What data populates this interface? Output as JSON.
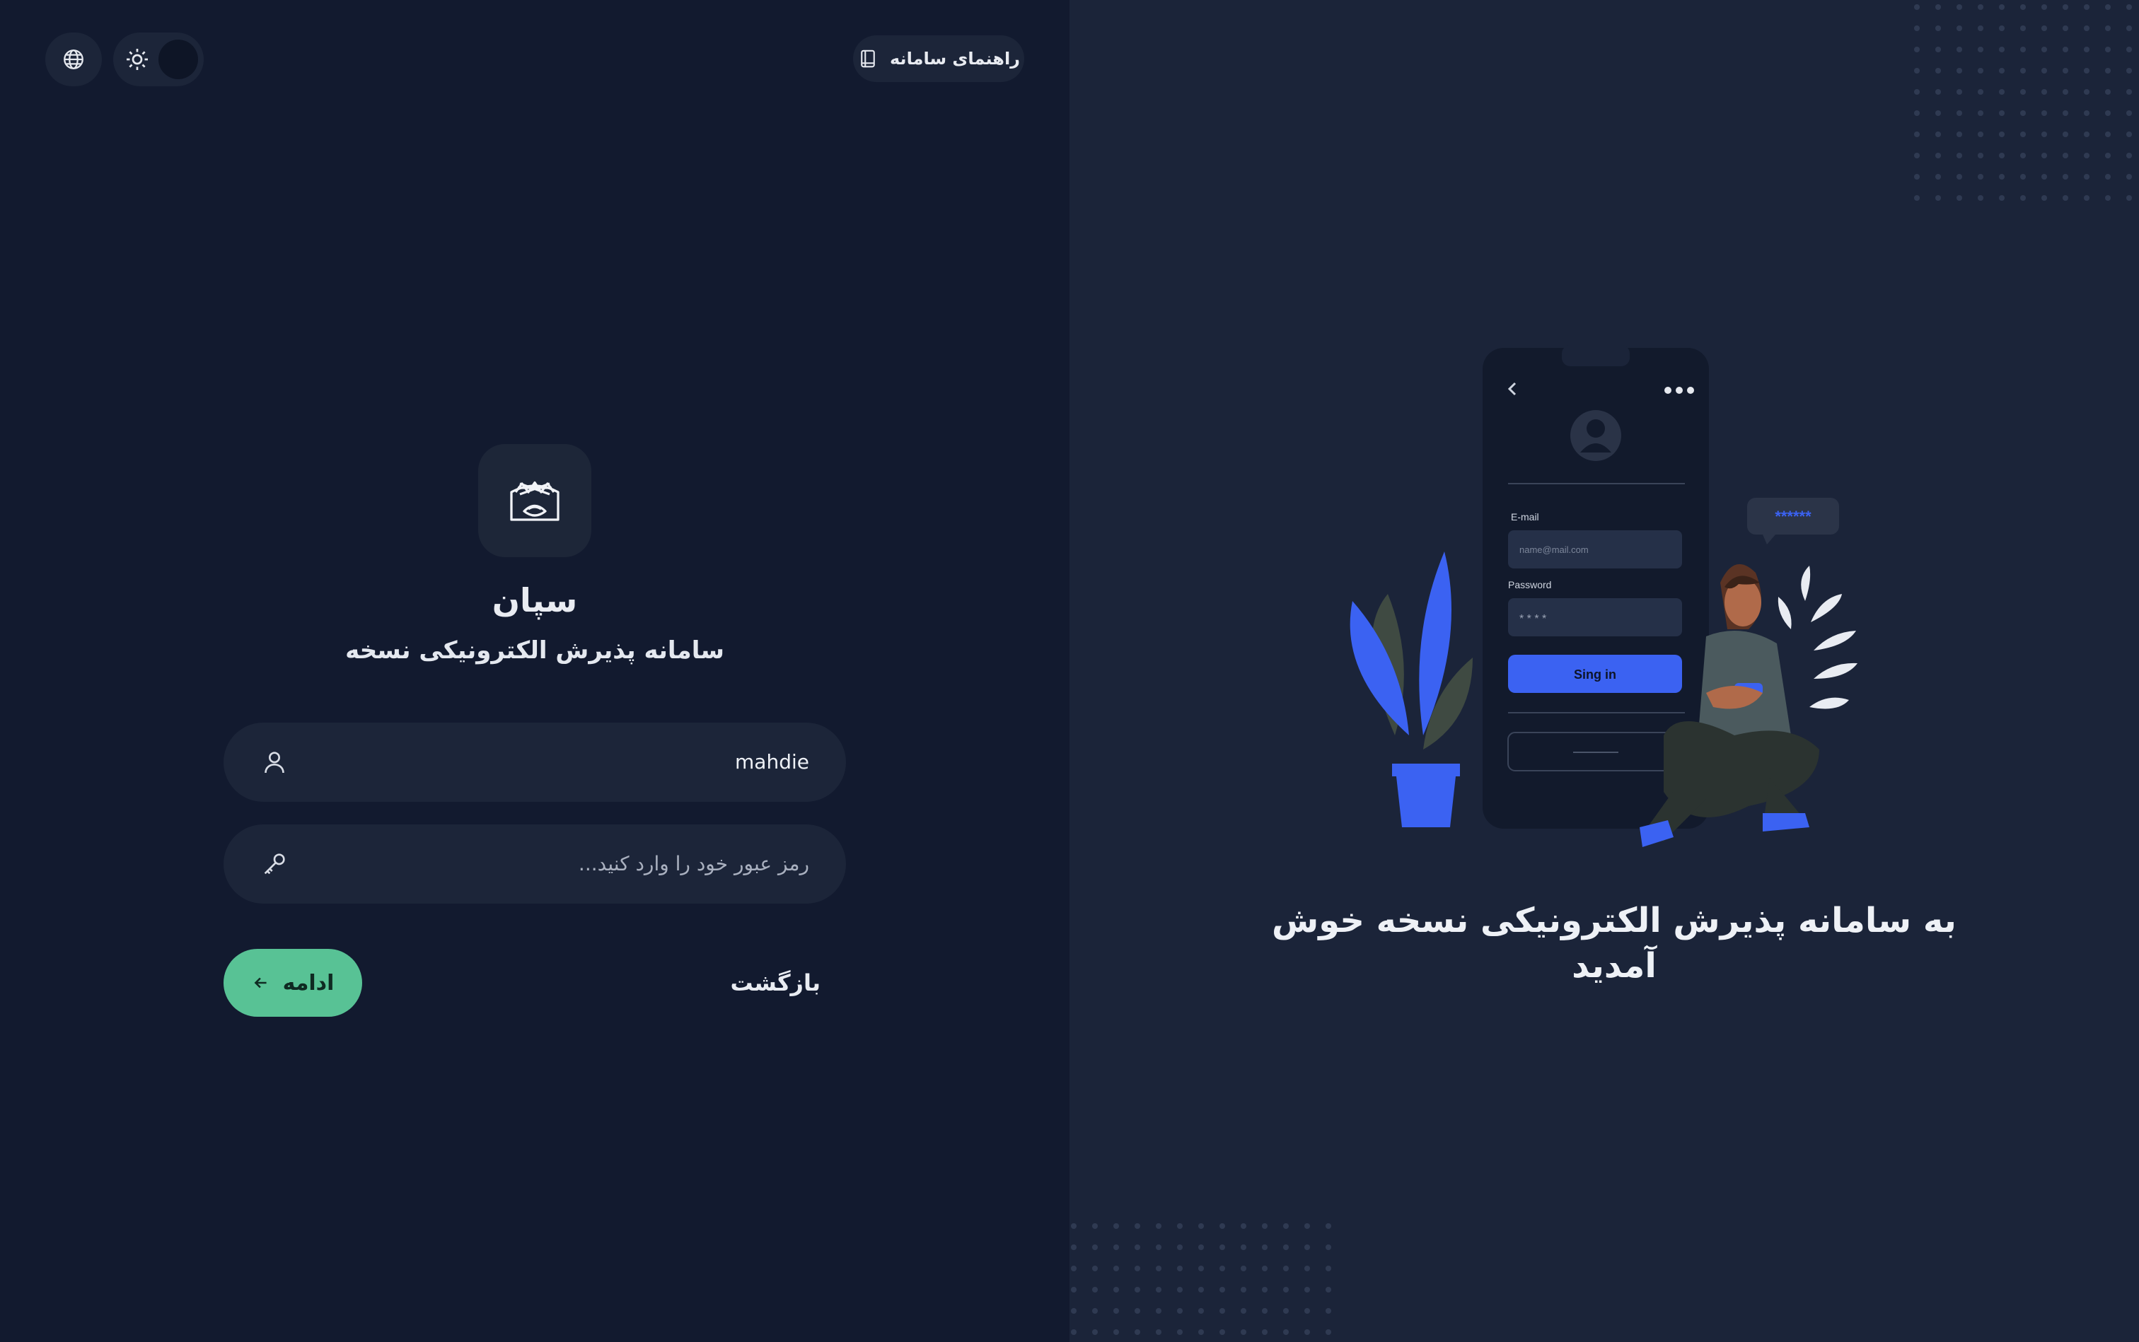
{
  "colors": {
    "background_left": "#121a2f",
    "background_right": "#1b2439",
    "surface": "#1c2539",
    "accent_green": "#58c295",
    "accent_blue": "#3b62f2",
    "text_primary": "#e9ecf2",
    "text_muted": "#a9b0bf"
  },
  "toolbar": {
    "language_icon": "globe-icon",
    "theme_icon": "sun-icon",
    "guide_label": "راهنمای سامانه",
    "guide_icon": "book-icon"
  },
  "brand": {
    "name": "سپان",
    "subtitle": "سامانه پذیرش الکترونیکی نسخه"
  },
  "form": {
    "username_value": "mahdie",
    "username_icon": "user-icon",
    "password_placeholder": "رمز عبور خود را وارد کنید...",
    "password_icon": "key-icon",
    "continue_label": "ادامه",
    "continue_icon": "arrow-left-icon",
    "back_label": "بازگشت"
  },
  "illustration": {
    "email_label": "E-mail",
    "email_placeholder": "name@mail.com",
    "password_label": "Password",
    "password_masked": "* * * *",
    "signin_label": "Sing in",
    "bubble_text": "******"
  },
  "welcome": {
    "line1": "به سامانه پذیرش الکترونیکی نسخه خوش",
    "line2": "آمدید"
  }
}
